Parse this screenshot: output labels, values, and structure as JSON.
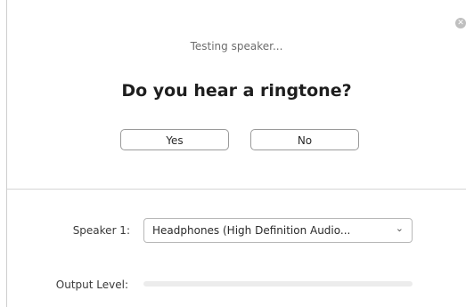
{
  "test": {
    "status_text": "Testing speaker...",
    "question": "Do you hear a ringtone?",
    "yes_label": "Yes",
    "no_label": "No"
  },
  "close_icon": "close-icon",
  "speaker": {
    "label": "Speaker 1:",
    "selected": "Headphones (High Definition Audio...",
    "dropdown_icon": "chevron-down-icon"
  },
  "output": {
    "label": "Output Level:",
    "level": 0
  }
}
